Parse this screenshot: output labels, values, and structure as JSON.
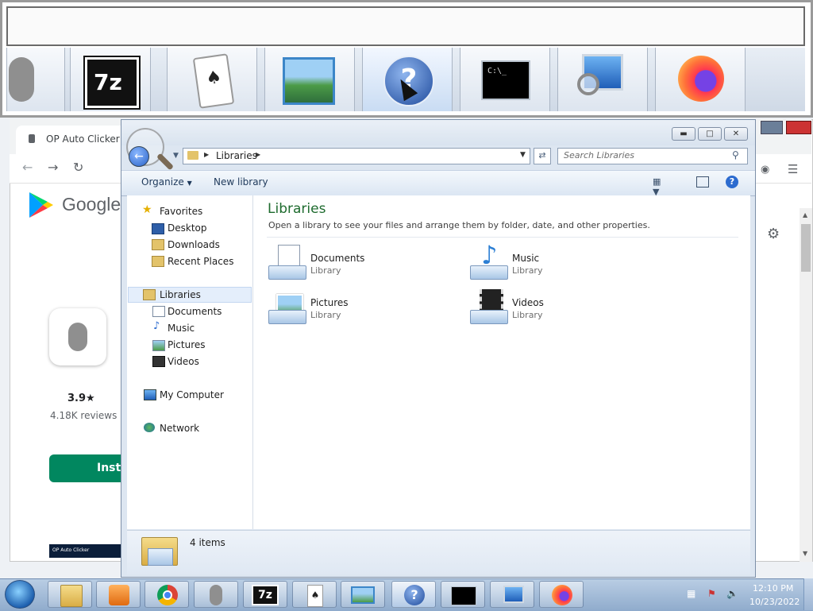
{
  "browser": {
    "tab_title": "OP Auto Clicker",
    "brand": "Google",
    "rating": "3.9★",
    "reviews": "4.18K reviews",
    "install_label": "Insta",
    "screenshot_caption": "OP Auto Clicker"
  },
  "switcher": {
    "items": [
      "mouse",
      "7z",
      "solitaire",
      "photo-viewer",
      "help",
      "cmd",
      "explorer-search",
      "firefox"
    ],
    "selected": "help",
    "sevenzip_label": "7z",
    "cmd_label": "C:\\_"
  },
  "explorer": {
    "address": "Libraries",
    "search_placeholder": "Search Libraries",
    "organize_label": "Organize",
    "new_library_label": "New library",
    "nav": {
      "favorites": "Favorites",
      "desktop": "Desktop",
      "downloads": "Downloads",
      "recent_places": "Recent Places",
      "libraries": "Libraries",
      "documents": "Documents",
      "music": "Music",
      "pictures": "Pictures",
      "videos": "Videos",
      "my_computer": "My Computer",
      "network": "Network"
    },
    "heading": "Libraries",
    "description": "Open a library to see your files and arrange them by folder, date, and other properties.",
    "libraries": [
      {
        "name": "Documents",
        "type": "Library"
      },
      {
        "name": "Music",
        "type": "Library"
      },
      {
        "name": "Pictures",
        "type": "Library"
      },
      {
        "name": "Videos",
        "type": "Library"
      }
    ],
    "status": "4 items"
  },
  "taskbar": {
    "time": "12:10 PM",
    "date": "10/23/2022",
    "sevenzip_label": "7z"
  },
  "colors": {
    "heading_green": "#1e6b2e",
    "install_green": "#01875f",
    "taskbar_blue": "#8fabcc"
  }
}
